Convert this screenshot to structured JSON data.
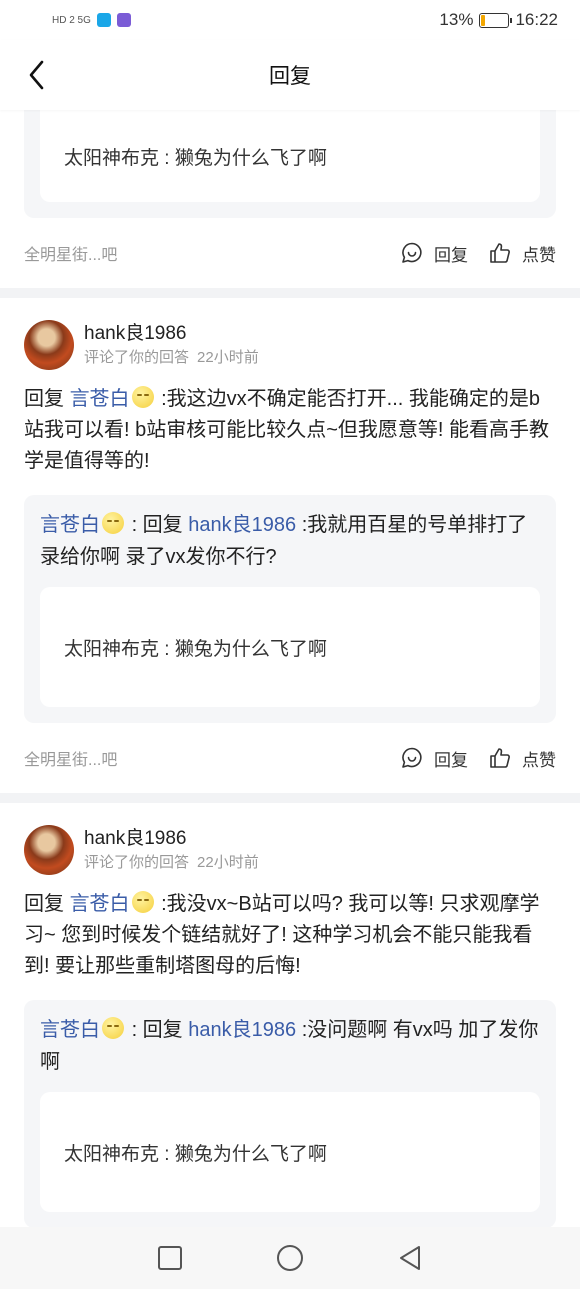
{
  "status_bar": {
    "network": "HD 2  5G",
    "battery": "13%",
    "battery_level": 0.13,
    "time": "16:22"
  },
  "header": {
    "title": "回复"
  },
  "cards": [
    {
      "quote_origin": "太阳神布克 : 獭兔为什么飞了啊",
      "source": "全明星街...吧",
      "reply_label": "回复",
      "like_label": "点赞"
    },
    {
      "username": "hank良1986",
      "action_text": "评论了你的回答",
      "time": "22小时前",
      "reply_prefix": "回复",
      "reply_to": "言苍白",
      "body": ":我这边vx不确定能否打开... 我能确定的是b站我可以看! b站审核可能比较久点~但我愿意等! 能看高手教学是值得等的!",
      "quote_user": "言苍白",
      "quote_prefix": ": 回复",
      "quote_target": "hank良1986",
      "quote_text": ":我就用百星的号单排打了录给你啊 录了vx发你不行?",
      "quote_origin": "太阳神布克 : 獭兔为什么飞了啊",
      "source": "全明星街...吧",
      "reply_label": "回复",
      "like_label": "点赞"
    },
    {
      "username": "hank良1986",
      "action_text": "评论了你的回答",
      "time": "22小时前",
      "reply_prefix": "回复",
      "reply_to": "言苍白",
      "body": ":我没vx~B站可以吗? 我可以等! 只求观摩学习~ 您到时候发个链结就好了! 这种学习机会不能只能我看到! 要让那些重制塔图母的后悔!",
      "quote_user": "言苍白",
      "quote_prefix": ": 回复",
      "quote_target": "hank良1986",
      "quote_text": ":没问题啊 有vx吗 加了发你啊",
      "quote_origin": "太阳神布克 : 獭兔为什么飞了啊"
    }
  ],
  "icons": {
    "back": "chevron-left-icon",
    "reply": "comment-bubble-icon",
    "like": "thumbs-up-icon",
    "nav_recent": "square-icon",
    "nav_home": "circle-icon",
    "nav_back": "triangle-back-icon"
  },
  "colors": {
    "link": "#3a5ca8",
    "battery": "#f2a600"
  }
}
